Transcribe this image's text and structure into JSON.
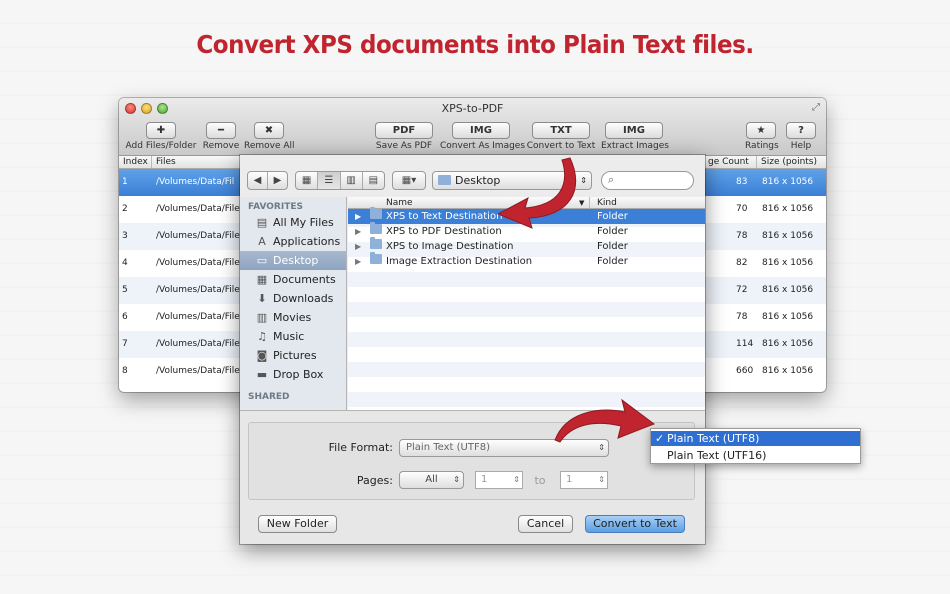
{
  "headline": "Convert XPS documents into Plain Text files.",
  "window": {
    "title": "XPS-to-PDF",
    "toolbar": [
      {
        "glyph": "✚",
        "label": "Add Files/Folder"
      },
      {
        "glyph": "━",
        "label": "Remove"
      },
      {
        "glyph": "✖",
        "label": "Remove All"
      },
      {
        "glyph": "PDF",
        "label": "Save As PDF"
      },
      {
        "glyph": "IMG",
        "label": "Convert As Images"
      },
      {
        "glyph": "TXT",
        "label": "Convert to Text"
      },
      {
        "glyph": "IMG",
        "label": "Extract Images"
      },
      {
        "glyph": "★",
        "label": "Ratings"
      },
      {
        "glyph": "?",
        "label": "Help"
      }
    ],
    "columns": {
      "index": "Index",
      "files": "Files",
      "page_count": "ge Count",
      "size": "Size (points)"
    },
    "rows": [
      {
        "index": "1",
        "file": "/Volumes/Data/Fil",
        "pages": "83",
        "size": "816 x 1056"
      },
      {
        "index": "2",
        "file": "/Volumes/Data/File",
        "pages": "70",
        "size": "816 x 1056"
      },
      {
        "index": "3",
        "file": "/Volumes/Data/File",
        "pages": "78",
        "size": "816 x 1056"
      },
      {
        "index": "4",
        "file": "/Volumes/Data/File",
        "pages": "82",
        "size": "816 x 1056"
      },
      {
        "index": "5",
        "file": "/Volumes/Data/File",
        "pages": "72",
        "size": "816 x 1056"
      },
      {
        "index": "6",
        "file": "/Volumes/Data/File",
        "pages": "78",
        "size": "816 x 1056"
      },
      {
        "index": "7",
        "file": "/Volumes/Data/File",
        "pages": "114",
        "size": "816 x 1056"
      },
      {
        "index": "8",
        "file": "/Volumes/Data/File",
        "pages": "660",
        "size": "816 x 1056"
      }
    ]
  },
  "sheet": {
    "location": "Desktop",
    "sidebar": {
      "favorites_header": "FAVORITES",
      "items": [
        {
          "icon": "▤",
          "label": "All My Files"
        },
        {
          "icon": "A",
          "label": "Applications"
        },
        {
          "icon": "▭",
          "label": "Desktop"
        },
        {
          "icon": "▦",
          "label": "Documents"
        },
        {
          "icon": "⬇",
          "label": "Downloads"
        },
        {
          "icon": "▥",
          "label": "Movies"
        },
        {
          "icon": "♫",
          "label": "Music"
        },
        {
          "icon": "◙",
          "label": "Pictures"
        },
        {
          "icon": "▬",
          "label": "Drop Box"
        }
      ],
      "shared_header": "SHARED"
    },
    "list_columns": {
      "name": "Name",
      "kind": "Kind"
    },
    "entries": [
      {
        "name": "XPS to Text Destination",
        "kind": "Folder"
      },
      {
        "name": "XPS to PDF Destination",
        "kind": "Folder"
      },
      {
        "name": "XPS to Image Destination",
        "kind": "Folder"
      },
      {
        "name": "Image Extraction Destination",
        "kind": "Folder"
      }
    ],
    "file_format_label": "File Format:",
    "file_format_value": "Plain Text (UTF8)",
    "pages_label": "Pages:",
    "pages_value": "All",
    "from_value": "1",
    "to_label": "to",
    "to_value": "1",
    "new_folder": "New Folder",
    "cancel": "Cancel",
    "confirm": "Convert to Text"
  },
  "format_menu": [
    {
      "check": "✓",
      "label": "Plain Text (UTF8)"
    },
    {
      "check": "",
      "label": "Plain Text (UTF16)"
    }
  ],
  "colors": {
    "headline": "#c0242e",
    "arrow": "#c0242e",
    "selection": "#3b7fd6"
  }
}
